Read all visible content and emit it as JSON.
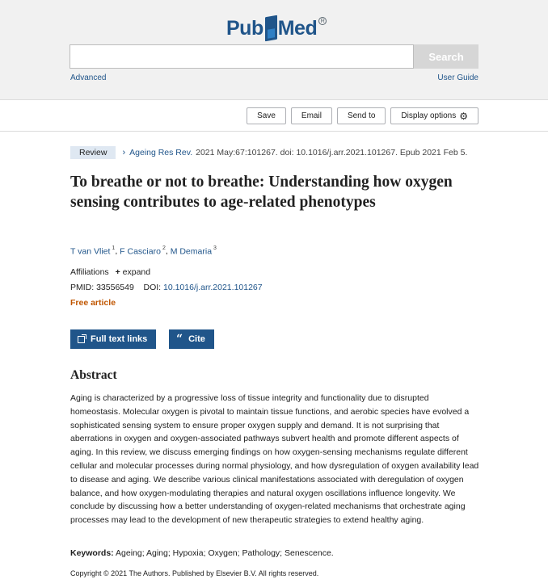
{
  "header": {
    "logo_pub": "Pub",
    "logo_med": "Med",
    "search_placeholder": "",
    "search_value": "",
    "search_button": "Search",
    "advanced_link": "Advanced",
    "user_guide_link": "User Guide"
  },
  "toolbar": {
    "save": "Save",
    "email": "Email",
    "send_to": "Send to",
    "display_options": "Display options"
  },
  "citation": {
    "type_badge": "Review",
    "journal": "Ageing Res Rev.",
    "details": "2021 May:67:101267. doi: 10.1016/j.arr.2021.101267. Epub 2021 Feb 5."
  },
  "article": {
    "title": "To breathe or not to breathe: Understanding how oxygen sensing contributes to age-related phenotypes",
    "authors": [
      {
        "name": "T van Vliet",
        "sup": "1"
      },
      {
        "name": "F Casciaro",
        "sup": "2"
      },
      {
        "name": "M Demaria",
        "sup": "3"
      }
    ],
    "affiliations_label": "Affiliations",
    "expand_label": "expand",
    "pmid_label": "PMID:",
    "pmid": "33556549",
    "doi_label": "DOI:",
    "doi": "10.1016/j.arr.2021.101267",
    "free_label": "Free article"
  },
  "actions": {
    "full_text": "Full text links",
    "cite": "Cite"
  },
  "abstract": {
    "heading": "Abstract",
    "text": "Aging is characterized by a progressive loss of tissue integrity and functionality due to disrupted homeostasis. Molecular oxygen is pivotal to maintain tissue functions, and aerobic species have evolved a sophisticated sensing system to ensure proper oxygen supply and demand. It is not surprising that aberrations in oxygen and oxygen-associated pathways subvert health and promote different aspects of aging. In this review, we discuss emerging findings on how oxygen-sensing mechanisms regulate different cellular and molecular processes during normal physiology, and how dysregulation of oxygen availability lead to disease and aging. We describe various clinical manifestations associated with deregulation of oxygen balance, and how oxygen-modulating therapies and natural oxygen oscillations influence longevity. We conclude by discussing how a better understanding of oxygen-related mechanisms that orchestrate aging processes may lead to the development of new therapeutic strategies to extend healthy aging.",
    "keywords_label": "Keywords:",
    "keywords": "Ageing; Aging; Hypoxia; Oxygen; Pathology; Senescence.",
    "copyright": "Copyright © 2021 The Authors. Published by Elsevier B.V. All rights reserved."
  }
}
